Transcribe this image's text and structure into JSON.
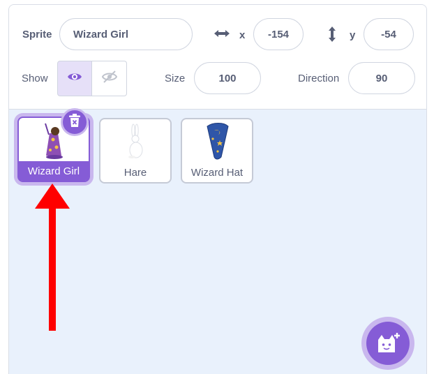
{
  "sprite_info": {
    "sprite_label": "Sprite",
    "sprite_name": "Wizard Girl",
    "x_label": "x",
    "x_value": "-154",
    "y_label": "y",
    "y_value": "-54",
    "show_label": "Show",
    "size_label": "Size",
    "size_value": "100",
    "direction_label": "Direction",
    "direction_value": "90"
  },
  "sprites": [
    {
      "name": "Wizard Girl",
      "selected": true
    },
    {
      "name": "Hare",
      "selected": false
    },
    {
      "name": "Wizard Hat",
      "selected": false
    }
  ],
  "colors": {
    "accent": "#855cd6",
    "accent_light": "#c9b7ee",
    "annotation_arrow": "#ff0000"
  }
}
